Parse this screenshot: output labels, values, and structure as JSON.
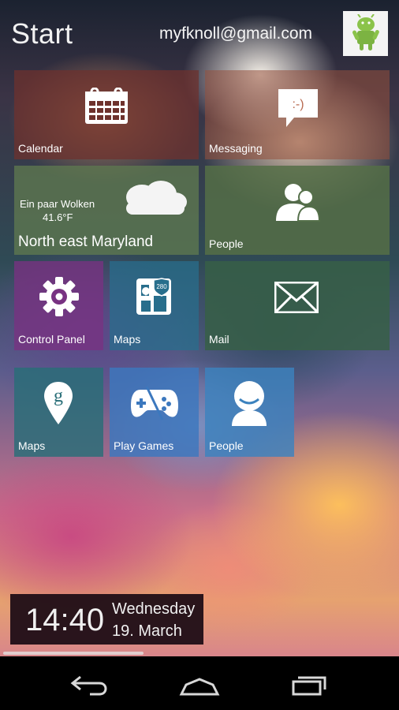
{
  "header": {
    "title": "Start",
    "account": "myfknoll@gmail.com"
  },
  "tiles": {
    "calendar": {
      "label": "Calendar"
    },
    "messaging": {
      "label": "Messaging"
    },
    "weather": {
      "condition": "Ein paar Wolken",
      "temperature": "41.6°F",
      "location": "North east Maryland"
    },
    "people_large": {
      "label": "People"
    },
    "control_panel": {
      "label": "Control Panel"
    },
    "maps_1": {
      "label": "Maps",
      "sign_number": "280"
    },
    "mail": {
      "label": "Mail"
    },
    "maps_2": {
      "label": "Maps"
    },
    "play_games": {
      "label": "Play Games"
    },
    "people_small": {
      "label": "People"
    }
  },
  "clock": {
    "time": "14:40",
    "weekday": "Wednesday",
    "date": "19. March"
  },
  "messaging_icon_text": ":-)",
  "maps_icon_letter": "g"
}
